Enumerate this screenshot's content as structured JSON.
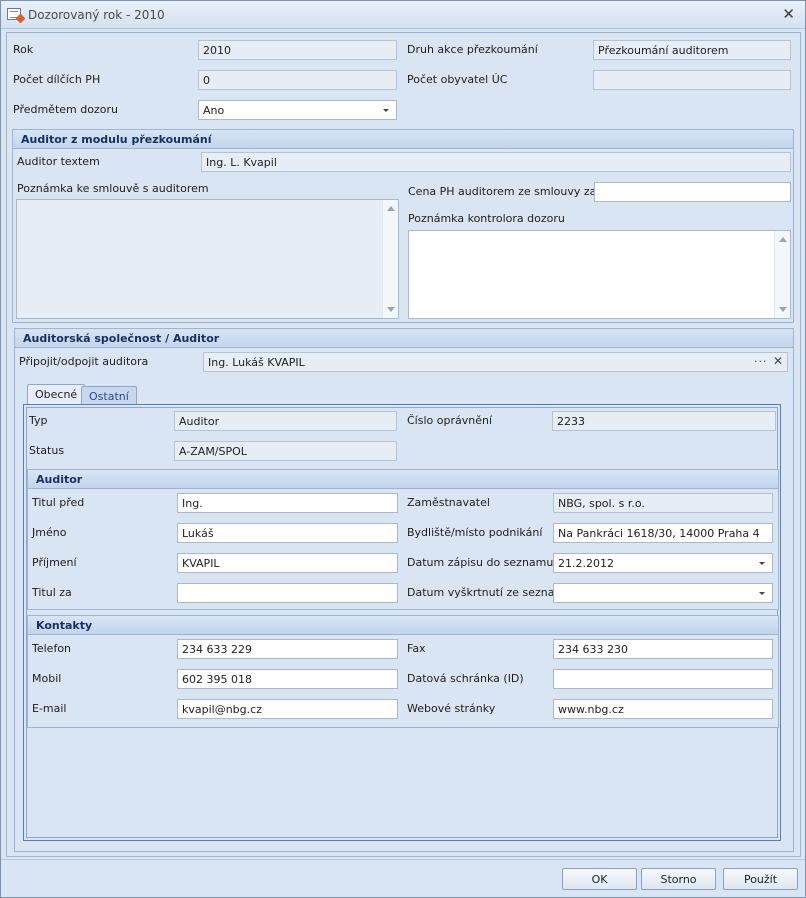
{
  "window": {
    "title": "Dozorovaný rok - 2010",
    "close_glyph": "✕"
  },
  "top": {
    "rok_label": "Rok",
    "rok_value": "2010",
    "druh_label": "Druh akce přezkoumání",
    "druh_value": "Přezkoumání auditorem",
    "pocet_ph_label": "Počet dílčích PH",
    "pocet_ph_value": "0",
    "pocet_obyvatel_label": "Počet obyvatel ÚC",
    "pocet_obyvatel_value": "",
    "predmetem_label": "Předmětem dozoru",
    "predmetem_value": "Ano"
  },
  "auditor_modul": {
    "header": "Auditor z modulu přezkoumání",
    "auditor_textem_label": "Auditor textem",
    "auditor_textem_value": "Ing. L. Kvapil",
    "poznamka_smlouva_label": "Poznámka ke smlouvě s auditorem",
    "cena_label": "Cena PH auditorem ze smlouvy za rok",
    "cena_value": "",
    "poznamka_kontrolora_label": "Poznámka kontrolora dozoru"
  },
  "spolecnost": {
    "header": "Auditorská společnost / Auditor",
    "pripojit_label": "Připojit/odpojit auditora",
    "pripojit_value": "Ing. Lukáš KVAPIL",
    "ellipsis": "···",
    "clear": "✕"
  },
  "tabs": [
    {
      "label": "Obecné"
    },
    {
      "label": "Ostatní"
    }
  ],
  "obecne": {
    "typ_label": "Typ",
    "typ_value": "Auditor",
    "cislo_label": "Číslo oprávnění",
    "cislo_value": "2233",
    "status_label": "Status",
    "status_value": "A-ZAM/SPOL"
  },
  "auditor": {
    "header": "Auditor",
    "titul_pred_label": "Titul před",
    "titul_pred_value": "Ing.",
    "zamestnavatel_label": "Zaměstnavatel",
    "zamestnavatel_value": "NBG, spol. s r.o.",
    "jmeno_label": "Jméno",
    "jmeno_value": "Lukáš",
    "bydliste_label": "Bydliště/místo podnikání",
    "bydliste_value": "Na Pankráci 1618/30, 14000  Praha 4",
    "prijmeni_label": "Příjmení",
    "prijmeni_value": "KVAPIL",
    "datum_zapisu_label": "Datum zápisu do seznamu",
    "datum_zapisu_value": "21.2.2012",
    "titul_za_label": "Titul za",
    "titul_za_value": "",
    "datum_vyskrtnuti_label": "Datum vyškrtnutí ze seznamu",
    "datum_vyskrtnuti_value": ""
  },
  "kontakty": {
    "header": "Kontakty",
    "telefon_label": "Telefon",
    "telefon_value": "234 633 229",
    "fax_label": "Fax",
    "fax_value": "234 633 230",
    "mobil_label": "Mobil",
    "mobil_value": "602 395 018",
    "datova_label": "Datová schránka (ID)",
    "datova_value": "",
    "email_label": "E-mail",
    "email_value": "kvapil@nbg.cz",
    "web_label": "Webové stránky",
    "web_value": "www.nbg.cz"
  },
  "buttons": {
    "ok": "OK",
    "storno": "Storno",
    "pouzit": "Použít"
  }
}
